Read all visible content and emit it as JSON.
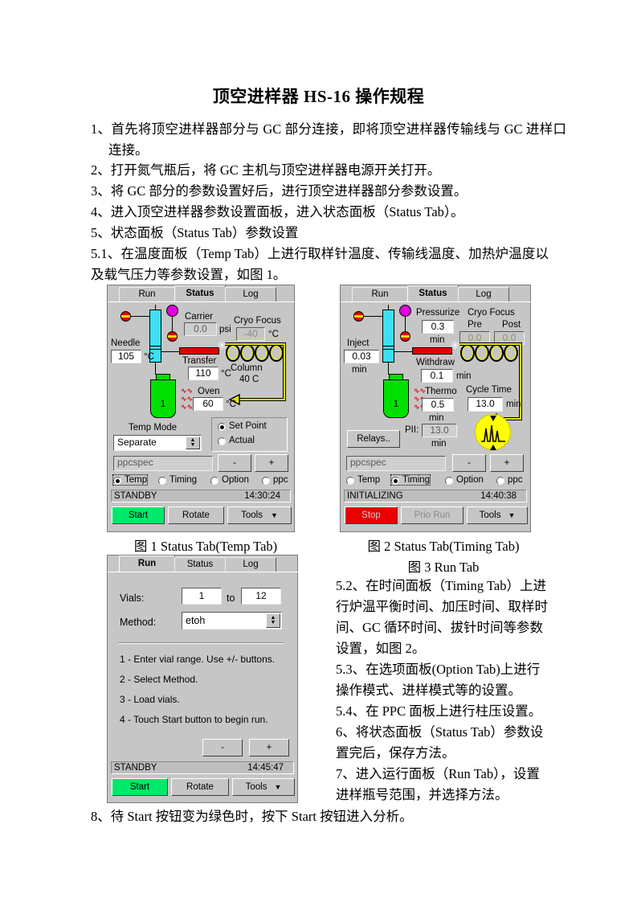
{
  "document": {
    "title": "顶空进样器 HS-16 操作规程",
    "paragraphs": [
      "1、首先将顶空进样器部分与 GC 部分连接，即将顶空进样器传输线与 GC 进样口连接。",
      "2、打开氮气瓶后，将 GC 主机与顶空进样器电源开关打开。",
      "3、将 GC 部分的参数设置好后，进行顶空进样器部分参数设置。",
      "4、进入顶空进样器参数设置面板，进入状态面板（Status Tab）。",
      "5、状态面板（Status Tab）参数设置",
      "5.1、在温度面板（Temp Tab）上进行取样针温度、传输线温度、加热炉温度以及载气压力等参数设置，如图 1。"
    ],
    "right_column": [
      "5.2、在时间面板（Timing Tab）上进行炉温平衡时间、加压时间、取样时间、GC 循环时间、拔针时间等参数设置，如图 2。",
      "5.3、在选项面板(Option Tab)上进行操作模式、进样模式等的设置。",
      "5.4、在 PPC 面板上进行柱压设置。",
      "6、将状态面板（Status Tab）参数设置完后，保存方法。",
      "7、进入运行面板（Run Tab），设置进样瓶号范围，并选择方法。"
    ],
    "final_line": "8、待 Start 按钮变为绿色时，按下 Start 按钮进入分析。",
    "captions": {
      "fig1": "图 1 Status Tab(Temp Tab)",
      "fig2": "图 2 Status Tab(Timing Tab)",
      "fig3": "图 3 Run Tab"
    }
  },
  "colors": {
    "panel_face": "#c6c6c6",
    "start_green": "#00e86a",
    "stop_red": "#e80000",
    "vial_green": "#00e000",
    "syringe_cyan": "#3de0f0",
    "transfer_red": "#e00000",
    "chromatogram_yellow": "#ffff00",
    "column_yellow": "#e6e600"
  },
  "fig1": {
    "tabs": [
      {
        "label": "Run",
        "selected": false
      },
      {
        "label": "Status",
        "selected": true
      },
      {
        "label": "Log",
        "selected": false
      }
    ],
    "needle": {
      "label": "Needle",
      "value": "105",
      "unit": "°C"
    },
    "carrier": {
      "label": "Carrier",
      "value": "0.0",
      "unit": "psi"
    },
    "cryo_focus": {
      "label": "Cryo Focus",
      "value": "-40",
      "unit": "°C",
      "enabled": false
    },
    "transfer": {
      "label": "Transfer",
      "value": "110",
      "unit": "°C"
    },
    "column": {
      "label": "Column",
      "value": "40 C"
    },
    "oven": {
      "label": "Oven",
      "value": "60",
      "unit": "°C"
    },
    "temp_mode": {
      "label": "Temp Mode",
      "value": "Separate"
    },
    "display_mode": {
      "options": [
        "Set Point",
        "Actual"
      ],
      "selected": "Set Point"
    },
    "method_field": "ppcspec",
    "minus_label": "-",
    "plus_label": "+",
    "param_tabs": [
      {
        "label": "Temp",
        "selected": true
      },
      {
        "label": "Timing",
        "selected": false
      },
      {
        "label": "Option",
        "selected": false
      },
      {
        "label": "ppc",
        "selected": false
      }
    ],
    "status": {
      "state": "STANDBY",
      "time": "14:30:24"
    },
    "buttons": {
      "start": "Start",
      "rotate": "Rotate",
      "tools": "Tools"
    },
    "vial_number": "1"
  },
  "fig2": {
    "tabs": [
      {
        "label": "Run",
        "selected": false
      },
      {
        "label": "Status",
        "selected": true
      },
      {
        "label": "Log",
        "selected": false
      }
    ],
    "inject": {
      "label": "Inject",
      "value": "0.03",
      "unit": "min"
    },
    "pressurize": {
      "label": "Pressurize",
      "value": "0.3",
      "unit": "min"
    },
    "cryo_focus": {
      "label": "Cryo Focus",
      "pre": {
        "label": "Pre",
        "value": "0.0",
        "enabled": false
      },
      "post": {
        "label": "Post",
        "value": "0.0",
        "enabled": false
      }
    },
    "withdraw": {
      "label": "Withdraw",
      "value": "0.1",
      "unit": "min"
    },
    "thermo": {
      "label": "Thermo",
      "value": "0.5",
      "unit": "min"
    },
    "cycle_time": {
      "label": "Cycle Time",
      "value": "13.0",
      "unit": "min"
    },
    "pii": {
      "label": "PII:",
      "value": "13.0",
      "unit": "min"
    },
    "relays_label": "Relays..",
    "method_field": "ppcspec",
    "minus_label": "-",
    "plus_label": "+",
    "param_tabs": [
      {
        "label": "Temp",
        "selected": false
      },
      {
        "label": "Timing",
        "selected": true
      },
      {
        "label": "Option",
        "selected": false
      },
      {
        "label": "ppc",
        "selected": false
      }
    ],
    "status": {
      "state": "INITIALIZING",
      "time": "14:40:38"
    },
    "buttons": {
      "stop": "Stop",
      "prio_run": "Prio Run",
      "tools": "Tools"
    },
    "vial_number": "1"
  },
  "fig3": {
    "tabs": [
      {
        "label": "Run",
        "selected": true
      },
      {
        "label": "Status",
        "selected": false
      },
      {
        "label": "Log",
        "selected": false
      }
    ],
    "vials": {
      "label": "Vials:",
      "from": "1",
      "to_label": "to",
      "to": "12"
    },
    "method": {
      "label": "Method:",
      "value": "etoh"
    },
    "instructions": [
      "1 - Enter vial range. Use +/- buttons.",
      "2 - Select Method.",
      "3 - Load vials.",
      "4 - Touch Start button to begin run."
    ],
    "minus_label": "-",
    "plus_label": "+",
    "status": {
      "state": "STANDBY",
      "time": "14:45:47"
    },
    "buttons": {
      "start": "Start",
      "rotate": "Rotate",
      "tools": "Tools"
    }
  }
}
